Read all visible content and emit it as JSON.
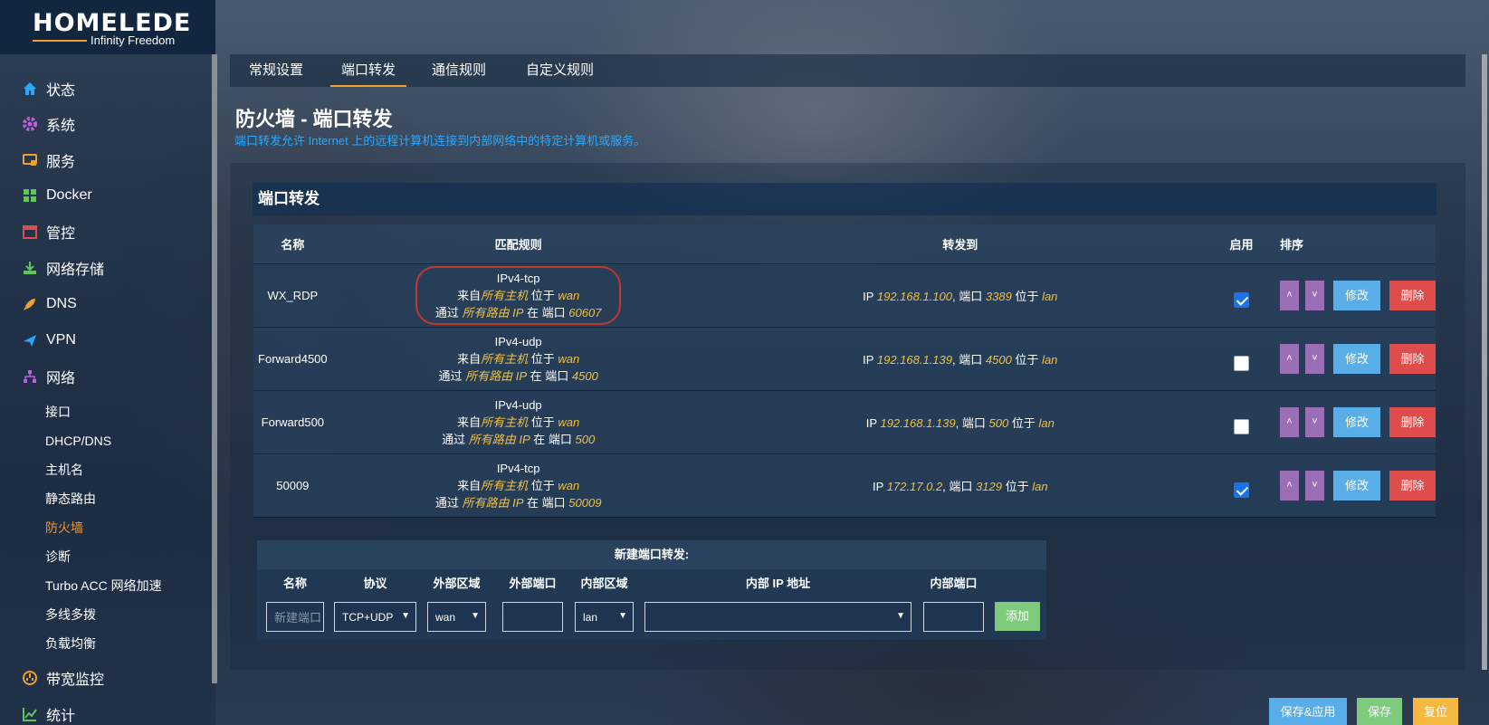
{
  "brand": {
    "logo": "HOMELEDE",
    "subtitle": "Infinity Freedom"
  },
  "sidebar": {
    "items": [
      {
        "label": "状态",
        "icon": "home-icon",
        "color": "#2aa8ff"
      },
      {
        "label": "系统",
        "icon": "gear-icon",
        "color": "#c05fe0"
      },
      {
        "label": "服务",
        "icon": "service-icon",
        "color": "#f0a030"
      },
      {
        "label": "Docker",
        "icon": "docker-icon",
        "color": "#5cc85c"
      },
      {
        "label": "管控",
        "icon": "calendar-icon",
        "color": "#e04b4b"
      },
      {
        "label": "网络存储",
        "icon": "download-icon",
        "color": "#5cc85c"
      },
      {
        "label": "DNS",
        "icon": "rocket-icon",
        "color": "#f0a030"
      },
      {
        "label": "VPN",
        "icon": "plane-icon",
        "color": "#2aa8ff"
      },
      {
        "label": "网络",
        "icon": "network-icon",
        "color": "#c05fe0"
      }
    ],
    "subitems": [
      "接口",
      "DHCP/DNS",
      "主机名",
      "静态路由",
      "防火墙",
      "诊断",
      "Turbo ACC 网络加速",
      "多线多拨",
      "负载均衡"
    ],
    "active_subitem": "防火墙",
    "bottom_items": [
      {
        "label": "带宽监控",
        "icon": "gauge-icon",
        "color": "#f0a030"
      },
      {
        "label": "统计",
        "icon": "chart-icon",
        "color": "#5cc85c"
      }
    ]
  },
  "tabs": [
    "常规设置",
    "端口转发",
    "通信规则",
    "自定义规则"
  ],
  "active_tab": "端口转发",
  "page": {
    "title": "防火墙 - 端口转发",
    "description": "端口转发允许 Internet 上的远程计算机连接到内部网络中的特定计算机或服务。"
  },
  "section": {
    "title": "端口转发"
  },
  "table": {
    "headers": [
      "名称",
      "匹配规则",
      "转发到",
      "启用",
      "排序"
    ],
    "rows": [
      {
        "name": "WX_RDP",
        "proto": "IPv4-tcp",
        "from_host": "所有主机",
        "from_zone": "wan",
        "via": "所有路由 IP",
        "port": "60607",
        "ip": "192.168.1.100",
        "dest_port": "3389",
        "dest_zone": "lan",
        "enabled": true,
        "circled": true
      },
      {
        "name": "Forward4500",
        "proto": "IPv4-udp",
        "from_host": "所有主机",
        "from_zone": "wan",
        "via": "所有路由 IP",
        "port": "4500",
        "ip": "192.168.1.139",
        "dest_port": "4500",
        "dest_zone": "lan",
        "enabled": false,
        "circled": false
      },
      {
        "name": "Forward500",
        "proto": "IPv4-udp",
        "from_host": "所有主机",
        "from_zone": "wan",
        "via": "所有路由 IP",
        "port": "500",
        "ip": "192.168.1.139",
        "dest_port": "500",
        "dest_zone": "lan",
        "enabled": false,
        "circled": false
      },
      {
        "name": "50009",
        "proto": "IPv4-tcp",
        "from_host": "所有主机",
        "from_zone": "wan",
        "via": "所有路由 IP",
        "port": "50009",
        "ip": "172.17.0.2",
        "dest_port": "3129",
        "dest_zone": "lan",
        "enabled": true,
        "circled": false
      }
    ],
    "labels": {
      "from": "来自",
      "at": "位于",
      "via": "通过",
      "on": "在 端口",
      "ip_prefix": "IP",
      "port_word": "端口"
    },
    "buttons": {
      "up": "˄",
      "down": "˅",
      "edit": "修改",
      "delete": "删除"
    }
  },
  "new_rule": {
    "title": "新建端口转发:",
    "headers": [
      "名称",
      "协议",
      "外部区域",
      "外部端口",
      "内部区域",
      "内部 IP 地址",
      "内部端口"
    ],
    "name_placeholder": "新建端口",
    "protocol": "TCP+UDP",
    "ext_zone": "wan",
    "int_zone": "lan",
    "add_label": "添加"
  },
  "footer": {
    "save_apply": "保存&应用",
    "save": "保存",
    "reset": "复位"
  }
}
